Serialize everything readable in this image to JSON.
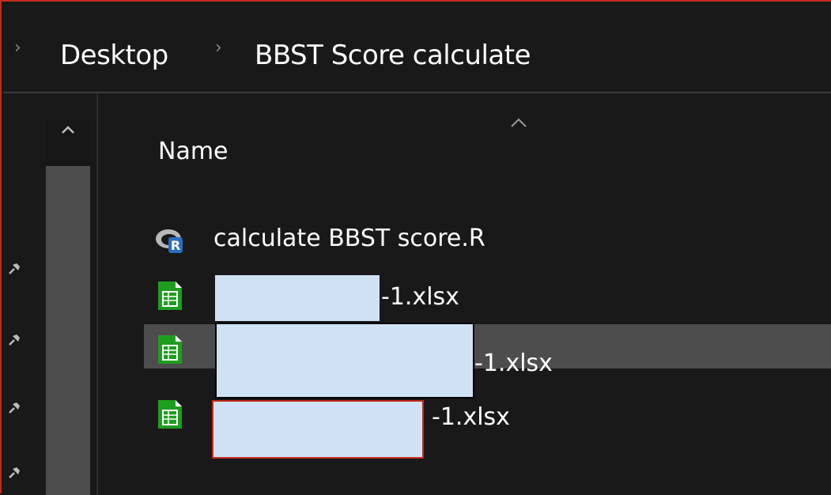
{
  "breadcrumb": {
    "items": [
      "Desktop",
      "BBST Score calculate"
    ]
  },
  "columns": {
    "name_label": "Name"
  },
  "files": [
    {
      "name": "calculate BBST score.R",
      "icon": "r-script-icon",
      "redacted": false,
      "selected": false
    },
    {
      "name": "-1.xlsx",
      "icon": "spreadsheet-icon",
      "redacted": true,
      "selected": false
    },
    {
      "name": "-1.xlsx",
      "icon": "spreadsheet-icon",
      "redacted": true,
      "selected": true
    },
    {
      "name": "-1.xlsx",
      "icon": "spreadsheet-icon",
      "redacted": true,
      "selected": false
    }
  ],
  "colors": {
    "background": "#191919",
    "selection": "#4d4d4d",
    "redaction": "#cfe2f3",
    "window_border": "#c42b1c",
    "sheet_icon_green": "#1e9e1e"
  }
}
